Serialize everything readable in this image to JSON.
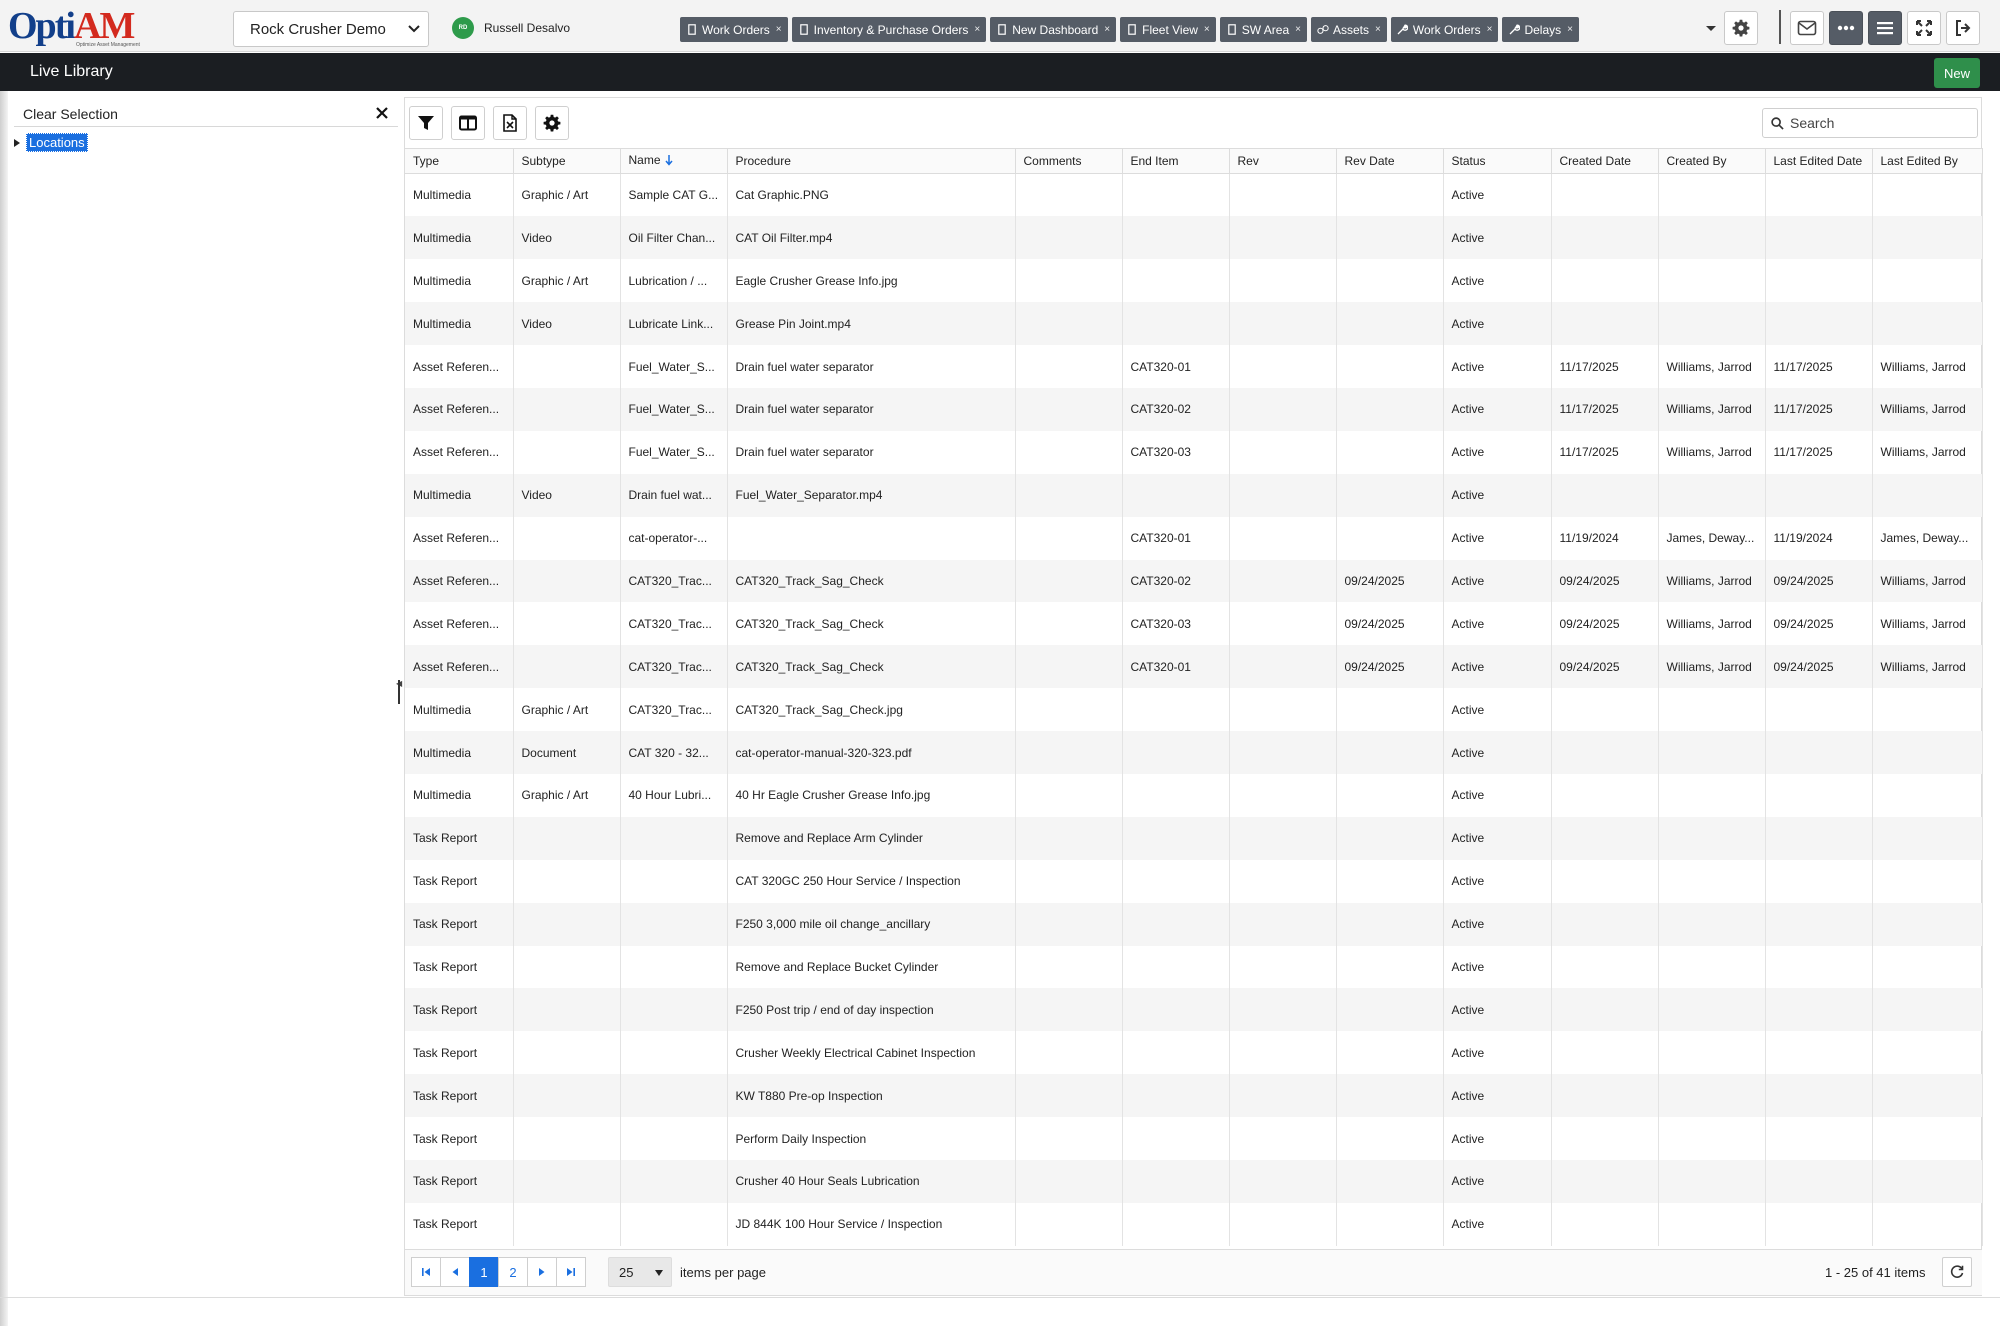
{
  "logo": {
    "part1": "Opti",
    "part2": "AM",
    "tagline": "Optimize Asset Management"
  },
  "site_select": {
    "value": "Rock Crusher Demo"
  },
  "user": {
    "initials": "RD",
    "name": "Russell Desalvo"
  },
  "tabs": [
    {
      "label": "Work Orders",
      "icon": "document-icon"
    },
    {
      "label": "Inventory & Purchase Orders",
      "icon": "document-icon"
    },
    {
      "label": "New Dashboard",
      "icon": "document-icon"
    },
    {
      "label": "Fleet View",
      "icon": "document-icon"
    },
    {
      "label": "SW Area",
      "icon": "document-icon"
    },
    {
      "label": "Assets",
      "icon": "assets-icon"
    },
    {
      "label": "Work Orders",
      "icon": "wrench-icon"
    },
    {
      "label": "Delays",
      "icon": "wrench-icon"
    }
  ],
  "page_title": "Live Library",
  "new_button": "New",
  "left_panel": {
    "clear_selection": "Clear Selection",
    "tree_root": "Locations"
  },
  "search": {
    "placeholder": "Search"
  },
  "columns": [
    "Type",
    "Subtype",
    "Name",
    "Procedure",
    "Comments",
    "End Item",
    "Rev",
    "Rev Date",
    "Status",
    "Created Date",
    "Created By",
    "Last Edited Date",
    "Last Edited By"
  ],
  "rows": [
    [
      "Multimedia",
      "Graphic / Art",
      "Sample CAT G...",
      "Cat Graphic.PNG",
      "",
      "",
      "",
      "",
      "Active",
      "",
      "",
      "",
      ""
    ],
    [
      "Multimedia",
      "Video",
      "Oil Filter Chan...",
      "CAT Oil Filter.mp4",
      "",
      "",
      "",
      "",
      "Active",
      "",
      "",
      "",
      ""
    ],
    [
      "Multimedia",
      "Graphic / Art",
      "Lubrication / ...",
      "Eagle Crusher Grease Info.jpg",
      "",
      "",
      "",
      "",
      "Active",
      "",
      "",
      "",
      ""
    ],
    [
      "Multimedia",
      "Video",
      "Lubricate Link...",
      "Grease Pin Joint.mp4",
      "",
      "",
      "",
      "",
      "Active",
      "",
      "",
      "",
      ""
    ],
    [
      "Asset Referen...",
      "",
      "Fuel_Water_S...",
      "Drain fuel water separator",
      "",
      "CAT320-01",
      "",
      "",
      "Active",
      "11/17/2025",
      "Williams, Jarrod",
      "11/17/2025",
      "Williams, Jarrod"
    ],
    [
      "Asset Referen...",
      "",
      "Fuel_Water_S...",
      "Drain fuel water separator",
      "",
      "CAT320-02",
      "",
      "",
      "Active",
      "11/17/2025",
      "Williams, Jarrod",
      "11/17/2025",
      "Williams, Jarrod"
    ],
    [
      "Asset Referen...",
      "",
      "Fuel_Water_S...",
      "Drain fuel water separator",
      "",
      "CAT320-03",
      "",
      "",
      "Active",
      "11/17/2025",
      "Williams, Jarrod",
      "11/17/2025",
      "Williams, Jarrod"
    ],
    [
      "Multimedia",
      "Video",
      "Drain fuel wat...",
      "Fuel_Water_Separator.mp4",
      "",
      "",
      "",
      "",
      "Active",
      "",
      "",
      "",
      ""
    ],
    [
      "Asset Referen...",
      "",
      "cat-operator-...",
      "",
      "",
      "CAT320-01",
      "",
      "",
      "Active",
      "11/19/2024",
      "James, Deway...",
      "11/19/2024",
      "James, Deway..."
    ],
    [
      "Asset Referen...",
      "",
      "CAT320_Trac...",
      "CAT320_Track_Sag_Check",
      "",
      "CAT320-02",
      "",
      "09/24/2025",
      "Active",
      "09/24/2025",
      "Williams, Jarrod",
      "09/24/2025",
      "Williams, Jarrod"
    ],
    [
      "Asset Referen...",
      "",
      "CAT320_Trac...",
      "CAT320_Track_Sag_Check",
      "",
      "CAT320-03",
      "",
      "09/24/2025",
      "Active",
      "09/24/2025",
      "Williams, Jarrod",
      "09/24/2025",
      "Williams, Jarrod"
    ],
    [
      "Asset Referen...",
      "",
      "CAT320_Trac...",
      "CAT320_Track_Sag_Check",
      "",
      "CAT320-01",
      "",
      "09/24/2025",
      "Active",
      "09/24/2025",
      "Williams, Jarrod",
      "09/24/2025",
      "Williams, Jarrod"
    ],
    [
      "Multimedia",
      "Graphic / Art",
      "CAT320_Trac...",
      "CAT320_Track_Sag_Check.jpg",
      "",
      "",
      "",
      "",
      "Active",
      "",
      "",
      "",
      ""
    ],
    [
      "Multimedia",
      "Document",
      "CAT 320 - 32...",
      "cat-operator-manual-320-323.pdf",
      "",
      "",
      "",
      "",
      "Active",
      "",
      "",
      "",
      ""
    ],
    [
      "Multimedia",
      "Graphic / Art",
      "40 Hour Lubri...",
      "40 Hr Eagle Crusher Grease Info.jpg",
      "",
      "",
      "",
      "",
      "Active",
      "",
      "",
      "",
      ""
    ],
    [
      "Task Report",
      "",
      "",
      "Remove and Replace Arm Cylinder",
      "",
      "",
      "",
      "",
      "Active",
      "",
      "",
      "",
      ""
    ],
    [
      "Task Report",
      "",
      "",
      "CAT 320GC 250 Hour Service / Inspection",
      "",
      "",
      "",
      "",
      "Active",
      "",
      "",
      "",
      ""
    ],
    [
      "Task Report",
      "",
      "",
      "F250 3,000 mile oil change_ancillary",
      "",
      "",
      "",
      "",
      "Active",
      "",
      "",
      "",
      ""
    ],
    [
      "Task Report",
      "",
      "",
      "Remove and Replace Bucket Cylinder",
      "",
      "",
      "",
      "",
      "Active",
      "",
      "",
      "",
      ""
    ],
    [
      "Task Report",
      "",
      "",
      "F250 Post trip / end of day inspection",
      "",
      "",
      "",
      "",
      "Active",
      "",
      "",
      "",
      ""
    ],
    [
      "Task Report",
      "",
      "",
      "Crusher Weekly Electrical Cabinet Inspection",
      "",
      "",
      "",
      "",
      "Active",
      "",
      "",
      "",
      ""
    ],
    [
      "Task Report",
      "",
      "",
      "KW T880 Pre-op Inspection",
      "",
      "",
      "",
      "",
      "Active",
      "",
      "",
      "",
      ""
    ],
    [
      "Task Report",
      "",
      "",
      "Perform Daily Inspection",
      "",
      "",
      "",
      "",
      "Active",
      "",
      "",
      "",
      ""
    ],
    [
      "Task Report",
      "",
      "",
      "Crusher 40 Hour Seals Lubrication",
      "",
      "",
      "",
      "",
      "Active",
      "",
      "",
      "",
      ""
    ],
    [
      "Task Report",
      "",
      "",
      "JD 844K 100 Hour Service / Inspection",
      "",
      "",
      "",
      "",
      "Active",
      "",
      "",
      "",
      ""
    ]
  ],
  "pager": {
    "pages": [
      "1",
      "2"
    ],
    "current_page": "1",
    "per_page": "25",
    "per_page_label": "items per page",
    "info": "1 - 25 of 41 items"
  },
  "colors": {
    "accent_blue": "#1a6fe0",
    "new_green": "#2f8f4b",
    "tab_gray": "#555c66",
    "title_bar": "#1b1e22",
    "logo_blue": "#123f8a",
    "logo_red": "#d32a1e"
  }
}
